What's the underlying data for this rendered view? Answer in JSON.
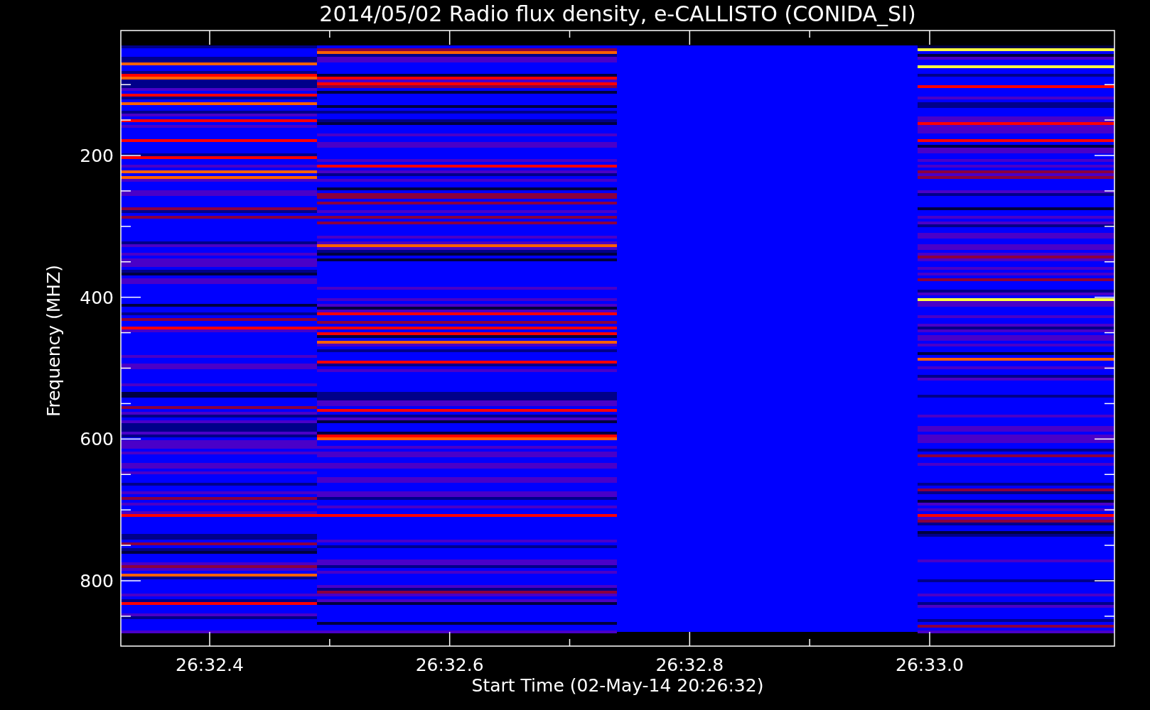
{
  "title": "2014/05/02  Radio flux density, e-CALLISTO (CONIDA_SI)",
  "y_axis": {
    "label": "Frequency (MHZ)",
    "tick_labels": [
      "200",
      "400",
      "600",
      "800"
    ]
  },
  "x_axis": {
    "label": "Start Time (02-May-14 20:26:32)",
    "tick_labels": [
      "26:32.4",
      "26:32.6",
      "26:32.8",
      "26:33.0"
    ]
  }
}
